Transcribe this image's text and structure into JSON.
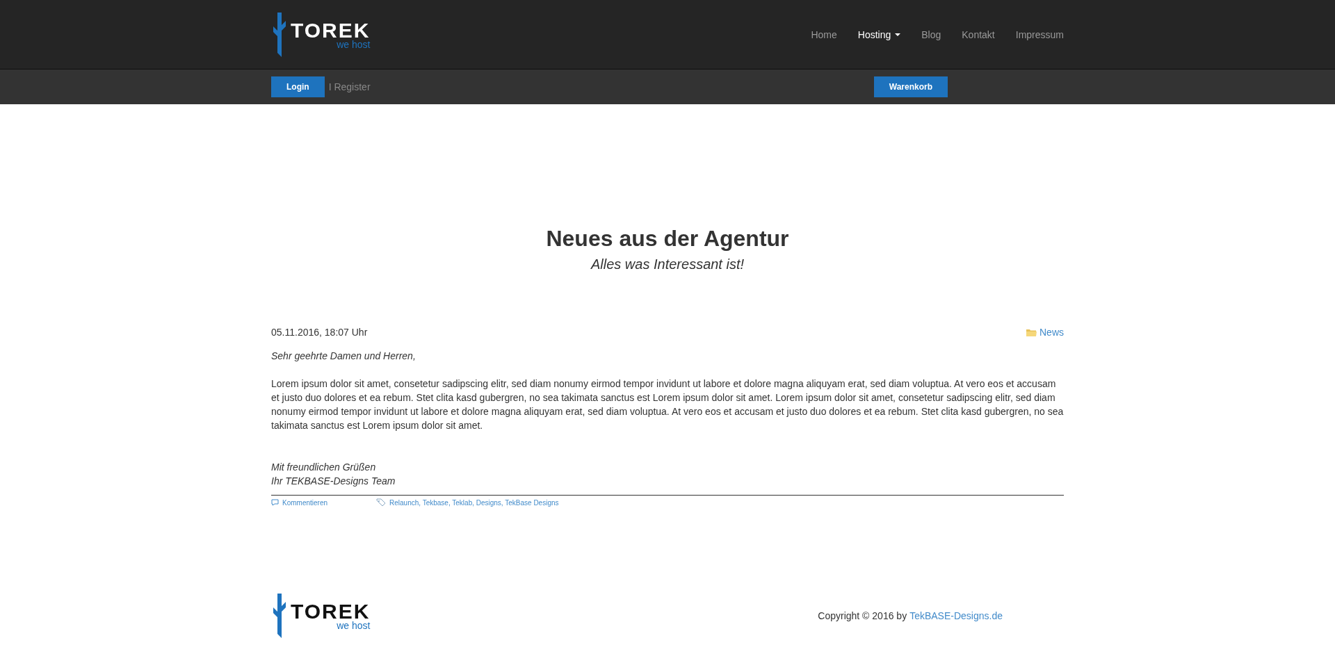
{
  "header": {
    "logo": {
      "name": "TOREK",
      "tagline": "we host"
    },
    "nav": [
      {
        "label": "Home",
        "selected": false,
        "dropdown": false
      },
      {
        "label": "Hosting",
        "selected": true,
        "dropdown": true
      },
      {
        "label": "Blog",
        "selected": false,
        "dropdown": false
      },
      {
        "label": "Kontakt",
        "selected": false,
        "dropdown": false
      },
      {
        "label": "Impressum",
        "selected": false,
        "dropdown": false
      }
    ]
  },
  "subbar": {
    "login": "Login",
    "register": "I Register",
    "cart": "Warenkorb"
  },
  "page": {
    "title": "Neues aus der Agentur",
    "subtitle": "Alles was Interessant ist!"
  },
  "post": {
    "date": "05.11.2016, 18:07 Uhr",
    "category": "News",
    "greeting": "Sehr geehrte Damen und Herren,",
    "body": "Lorem ipsum dolor sit amet, consetetur sadipscing elitr, sed diam nonumy eirmod tempor invidunt ut labore et dolore magna aliquyam erat, sed diam voluptua. At vero eos et accusam et justo duo dolores et ea rebum. Stet clita kasd gubergren, no sea takimata sanctus est Lorem ipsum dolor sit amet. Lorem ipsum dolor sit amet, consetetur sadipscing elitr, sed diam nonumy eirmod tempor invidunt ut labore et dolore magna aliquyam erat, sed diam voluptua. At vero eos et accusam et justo duo dolores et ea rebum. Stet clita kasd gubergren, no sea takimata sanctus est Lorem ipsum dolor sit amet.",
    "closing": [
      "Mit freundlichen Grüßen",
      "Ihr TEKBASE-Designs Team"
    ],
    "comments_link": "Kommentieren",
    "tags": "Relaunch, Tekbase, Teklab, Designs, TekBase Designs"
  },
  "footer": {
    "logo": {
      "name": "TOREK",
      "tagline": "we host"
    },
    "copyright": "Copyright © 2016 by",
    "copyright_link": "TekBASE-Designs.de"
  }
}
